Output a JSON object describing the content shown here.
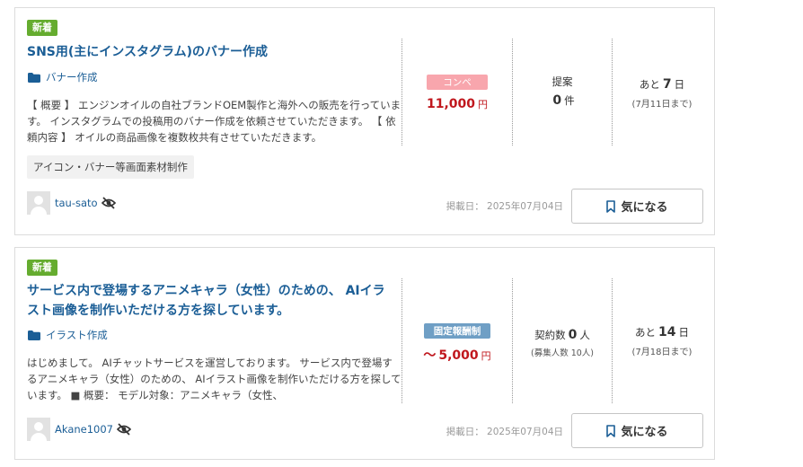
{
  "jobs": [
    {
      "badge": "新着",
      "title": "SNS用(主にインスタグラム)のバナー作成",
      "category": "バナー作成",
      "description": "【 概要 】 エンジンオイルの自社ブランドOEM製作と海外への販売を行っています。 インスタグラムでの投稿用のバナー作成を依頼させていただきます。 【 依頼内容 】 オイルの商品画像を複数枚共有させていただきます。",
      "tag": "アイコン・バナー等画面素材制作",
      "type_label": "コンペ",
      "price_prefix": "",
      "price": "11,000",
      "price_unit": "円",
      "proposal_label": "提案",
      "proposal_count": "0",
      "proposal_unit": "件",
      "proposal_sub": "",
      "remain_prefix": "あと",
      "remain_days": "7",
      "remain_unit": "日",
      "deadline": "(7月11日まで)",
      "user": "tau-sato",
      "posted": "掲載日： 2025年07月04日",
      "fav_label": "気になる"
    },
    {
      "badge": "新着",
      "title": "サービス内で登場するアニメキャラ（女性）のための、 AIイラスト画像を制作いただける方を探しています。",
      "category": "イラスト作成",
      "description": "はじめまして。 AIチャットサービスを運営しております。 サービス内で登場するアニメキャラ（女性）のための、 AIイラスト画像を制作いただける方を探しています。 ■ 概要： モデル対象：アニメキャラ（女性、",
      "type_label": "固定報酬制",
      "price_prefix": "～",
      "price": "5,000",
      "price_unit": "円",
      "proposal_label": "契約数",
      "proposal_count": "0",
      "proposal_unit": "人",
      "proposal_sub": "(募集人数 10人)",
      "remain_prefix": "あと",
      "remain_days": "14",
      "remain_unit": "日",
      "deadline": "(7月18日まで)",
      "user": "Akane1007",
      "posted": "掲載日： 2025年07月04日",
      "fav_label": "気になる"
    }
  ],
  "colors": {
    "new_badge": "#65ac2f",
    "title": "#1b5e96",
    "price": "#c0171d",
    "compe": "#f8a6ad",
    "fixed": "#6f9fc5"
  }
}
